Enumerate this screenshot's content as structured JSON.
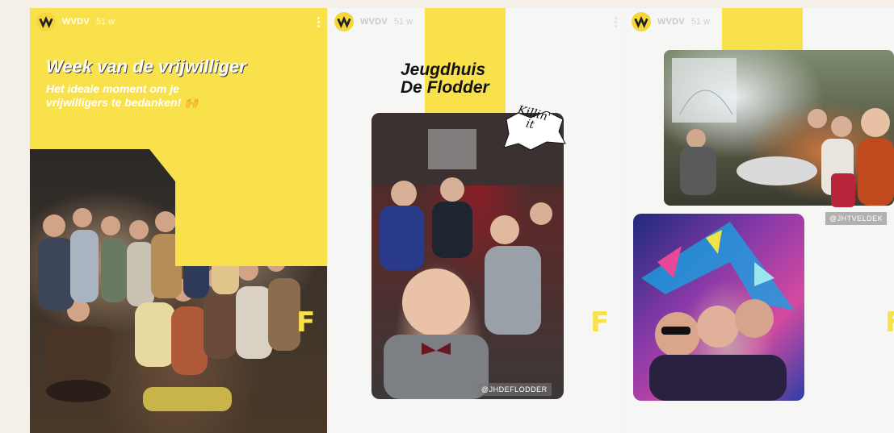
{
  "stories": [
    {
      "account": "WVDV",
      "time": "51 w",
      "title": "Week van de vrijwilliger",
      "subtitle": "Het ideale moment om je vrijwilligers te bedanken! 🙌"
    },
    {
      "account": "WVDV",
      "time": "51 w",
      "title_line1": "Jeugdhuis",
      "title_line2": "De Flodder",
      "sticker_line1": "Killin'",
      "sticker_line2": "it",
      "photo_tag": "@JHDEFLODDER"
    },
    {
      "account": "WVDV",
      "time": "51 w",
      "photo_tag": "@JHTVELDEK"
    }
  ],
  "colors": {
    "brand_yellow": "#f9e14b",
    "background": "#f4efe8"
  },
  "icons": [
    "avatar-logo",
    "more-options-icon",
    "flodder-f-logo"
  ]
}
